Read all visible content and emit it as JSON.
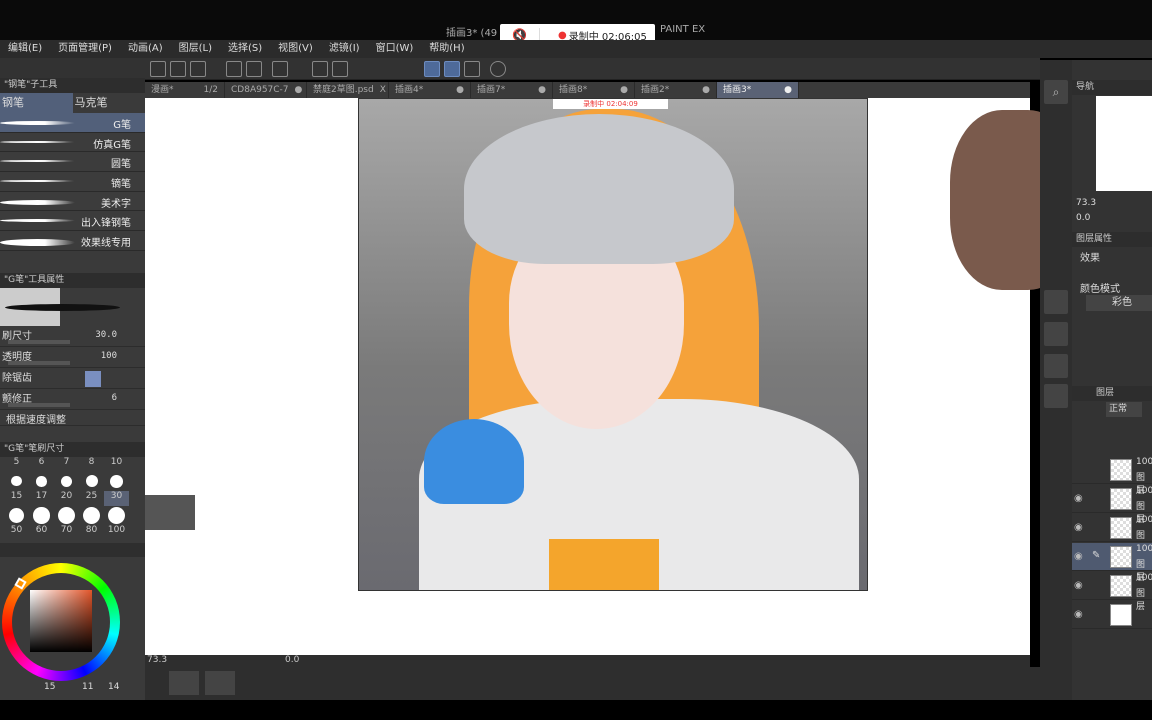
{
  "window": {
    "title": "插画3* (49",
    "title_suffix": "PAINT EX"
  },
  "recording": {
    "main": "录制中 02:06:05",
    "canvas_overlay": "录制中 02:04:09"
  },
  "menu": [
    "编辑(E)",
    "页面管理(P)",
    "动画(A)",
    "图层(L)",
    "选择(S)",
    "视图(V)",
    "滤镜(I)",
    "窗口(W)",
    "帮助(H)"
  ],
  "tabs": [
    {
      "label": "漫画*",
      "extra": "1/2"
    },
    {
      "label": "CD8A957C-7"
    },
    {
      "label": "禁庭2草图.psd",
      "extra": "X"
    },
    {
      "label": "插画4*"
    },
    {
      "label": "插画7*"
    },
    {
      "label": "插画8*"
    },
    {
      "label": "插画2*"
    },
    {
      "label": "插画3*",
      "active": true
    }
  ],
  "subtool": {
    "header": "\"钢笔\"子工具",
    "tabs": [
      "钢笔",
      "马克笔"
    ],
    "brushes": [
      "G笔",
      "仿真G笔",
      "圆笔",
      "镝笔",
      "美术字",
      "出入锋钢笔",
      "效果线专用"
    ],
    "selected": "G笔"
  },
  "tool_property": {
    "header": "\"G笔\"工具属性",
    "brush_size_label": "刷尺寸",
    "brush_size": "30.0",
    "opacity_label": "透明度",
    "opacity": "100",
    "antialias_label": "除锯齿",
    "stabilize_label": "颤修正",
    "stabilize": "6",
    "speed_label": "根据速度调整"
  },
  "brush_size_panel": {
    "header": "\"G笔\"笔刷尺寸",
    "sizes": [
      5,
      6,
      7,
      8,
      10,
      15,
      17,
      20,
      25,
      30,
      50,
      60,
      70,
      80,
      100
    ],
    "selected": 30
  },
  "color": {
    "h": "15",
    "s": "11",
    "v": "14",
    "current": "#1a0a06",
    "hue_marker": "#e2552a"
  },
  "status": {
    "zoom": "73.3",
    "rotation": "0.0"
  },
  "navigator": {
    "tab": "导航",
    "zoom": "73.3",
    "rotation": "0.0"
  },
  "layer_property": {
    "tab": "图层属性",
    "effect_label": "效果",
    "color_mode_label": "颜色模式",
    "color_mode": "彩色"
  },
  "layers": {
    "tab": "图层",
    "blend": "正常",
    "items": [
      {
        "opacity": "100",
        "name": "图层",
        "visible": false
      },
      {
        "opacity": "100",
        "name": "图层",
        "visible": true
      },
      {
        "opacity": "100",
        "name": "图层",
        "visible": true
      },
      {
        "opacity": "100",
        "name": "图层",
        "visible": true,
        "selected": true
      },
      {
        "opacity": "100",
        "name": "图层",
        "visible": true
      },
      {
        "opacity": "",
        "name": "",
        "visible": true
      }
    ]
  }
}
